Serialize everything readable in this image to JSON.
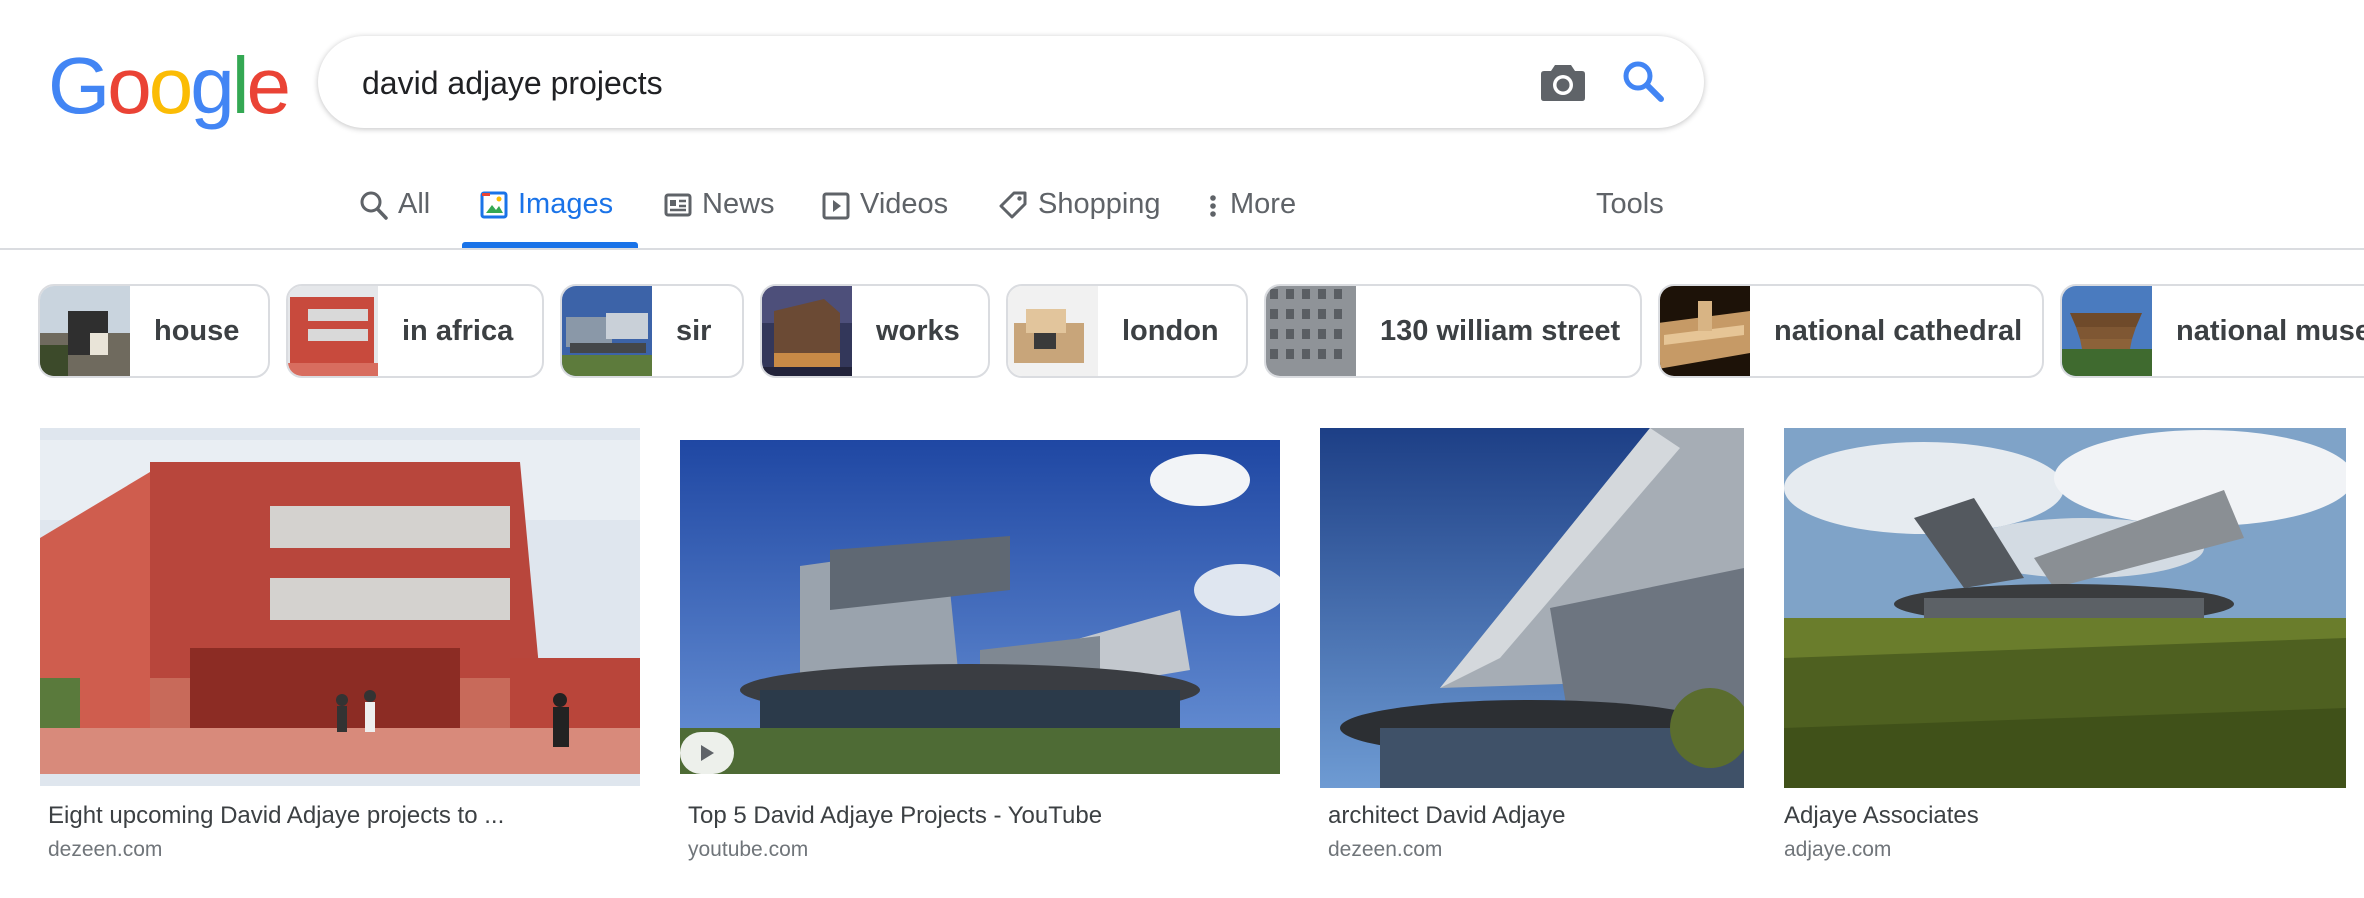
{
  "search": {
    "query": "david adjaye projects"
  },
  "logo": {
    "letters": [
      "G",
      "o",
      "o",
      "g",
      "l",
      "e"
    ]
  },
  "tabs": [
    {
      "label": "All",
      "icon": "search-icon"
    },
    {
      "label": "Images",
      "icon": "image-icon"
    },
    {
      "label": "News",
      "icon": "newspaper-icon"
    },
    {
      "label": "Videos",
      "icon": "play-icon"
    },
    {
      "label": "Shopping",
      "icon": "tag-icon"
    },
    {
      "label": "More",
      "icon": "more-vert-icon"
    }
  ],
  "tools_label": "Tools",
  "chips": [
    {
      "label": "house"
    },
    {
      "label": "in africa"
    },
    {
      "label": "sir"
    },
    {
      "label": "works"
    },
    {
      "label": "london"
    },
    {
      "label": "130 william street"
    },
    {
      "label": "national cathedral"
    },
    {
      "label": "national museum"
    }
  ],
  "results": [
    {
      "title": "Eight upcoming David Adjaye projects to ...",
      "source": "dezeen.com"
    },
    {
      "title": "Top 5 David Adjaye Projects - YouTube",
      "source": "youtube.com"
    },
    {
      "title": "architect David Adjaye",
      "source": "dezeen.com"
    },
    {
      "title": "Adjaye Associates",
      "source": "adjaye.com"
    }
  ],
  "colors": {
    "google_blue": "#4285f4",
    "google_red": "#ea4335",
    "google_yellow": "#fbbc05",
    "google_green": "#34a853",
    "active_tab": "#1a73e8"
  }
}
